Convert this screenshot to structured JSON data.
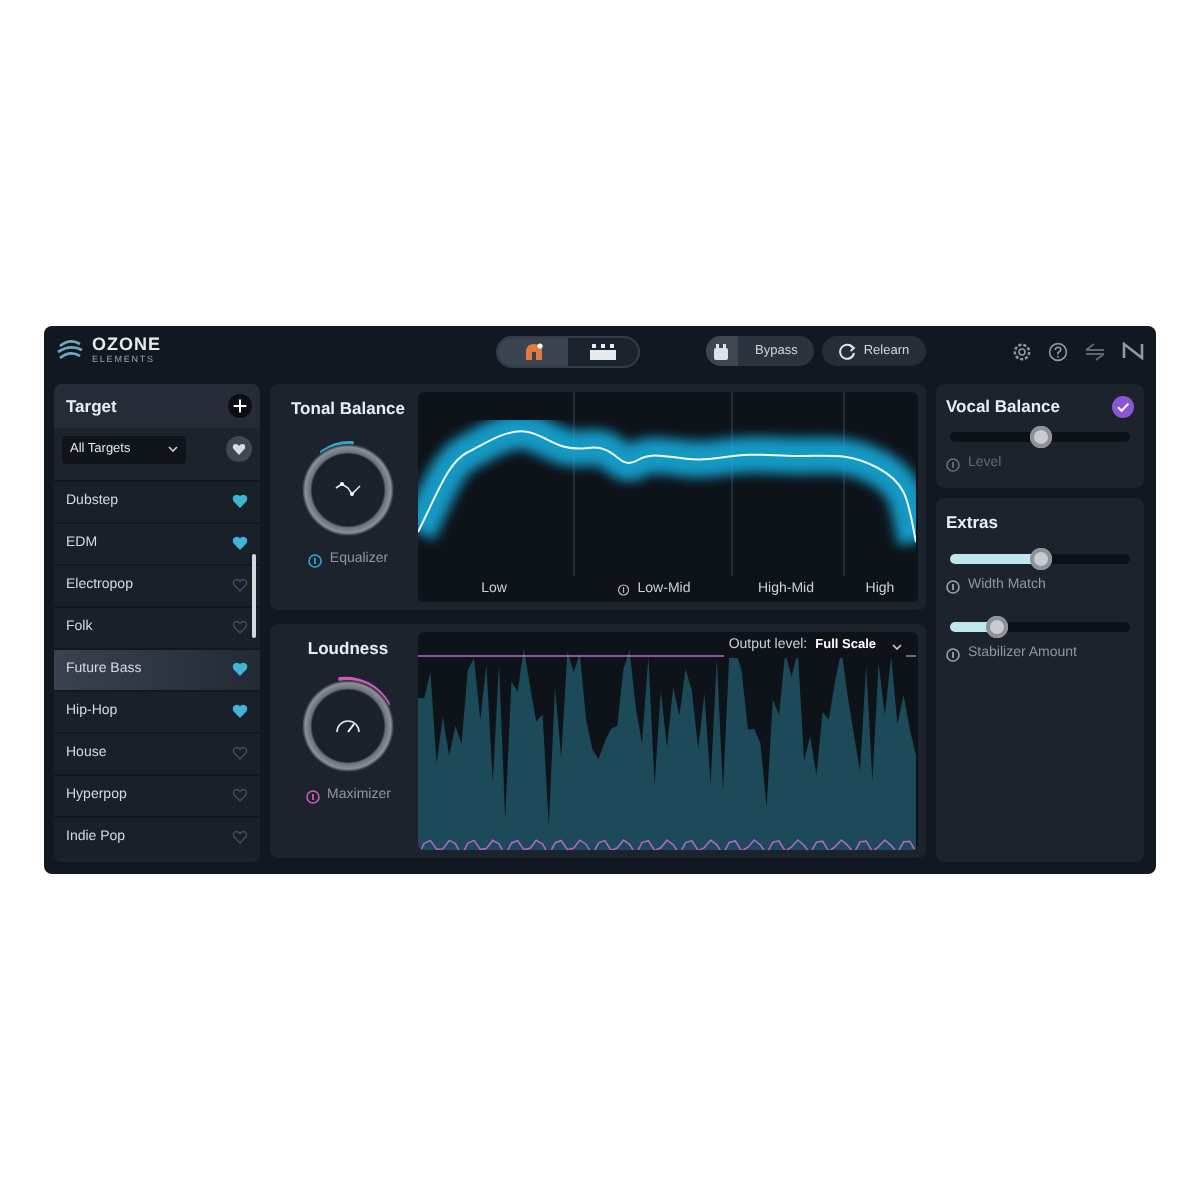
{
  "app": {
    "name": "OZONE",
    "subtitle": "ELEMENTS"
  },
  "view_tabs": [
    {
      "selected": true
    },
    {
      "selected": false
    }
  ],
  "header_buttons": [
    {
      "label": "Bypass",
      "kind": "bypass"
    },
    {
      "label": "Relearn",
      "kind": "relearn"
    }
  ],
  "target": {
    "title": "Target",
    "filter": "All Targets",
    "items": [
      {
        "label": "Dubstep",
        "favorite": true,
        "selected": false
      },
      {
        "label": "EDM",
        "favorite": true,
        "selected": false
      },
      {
        "label": "Electropop",
        "favorite": false,
        "selected": false
      },
      {
        "label": "Folk",
        "favorite": false,
        "selected": false
      },
      {
        "label": "Future Bass",
        "favorite": true,
        "selected": true
      },
      {
        "label": "Hip-Hop",
        "favorite": true,
        "selected": false
      },
      {
        "label": "House",
        "favorite": false,
        "selected": false
      },
      {
        "label": "Hyperpop",
        "favorite": false,
        "selected": false
      },
      {
        "label": "Indie Pop",
        "favorite": false,
        "selected": false
      }
    ]
  },
  "tonal_balance": {
    "title": "Tonal Balance",
    "module": "Equalizer",
    "bands": [
      "Low",
      "Low-Mid",
      "High-Mid",
      "High"
    ]
  },
  "loudness": {
    "title": "Loudness",
    "module": "Maximizer",
    "output_label": "Output level:",
    "output_value": "Full Scale"
  },
  "vocal_balance": {
    "title": "Vocal Balance",
    "checked": true,
    "slider": {
      "label": "Level",
      "level": 0.5
    }
  },
  "extras": {
    "title": "Extras",
    "sliders": [
      {
        "label": "Width Match",
        "level": 0.5
      },
      {
        "label": "Stabilizer Amount",
        "level": 0.26
      }
    ]
  }
}
